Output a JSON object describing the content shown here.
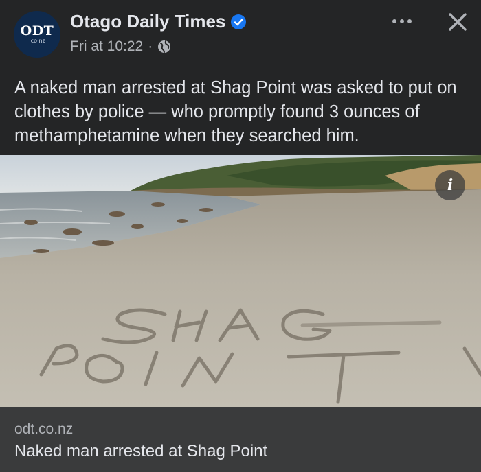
{
  "post": {
    "avatar": {
      "logo_main": "ODT",
      "logo_sub": "·co·nz"
    },
    "page_name": "Otago Daily Times",
    "timestamp": "Fri at 10:22",
    "separator": "·",
    "text": "A naked man arrested at Shag Point was asked to put on clothes by police — who promptly found 3 ounces of methamphetamine when they searched him.",
    "icons": {
      "verified": "verified-badge-icon",
      "audience": "globe-icon",
      "more": "more-options-icon",
      "close": "close-icon",
      "info": "info-icon"
    },
    "image": {
      "sand_writing": [
        "SHAG",
        "POINT"
      ]
    },
    "info_glyph": "i"
  },
  "link": {
    "domain": "odt.co.nz",
    "title": "Naked man arrested at Shag Point"
  },
  "colors": {
    "background": "#242526",
    "card": "#3a3b3c",
    "text_primary": "#e4e6eb",
    "text_secondary": "#b0b3b8",
    "verified": "#1877f2"
  }
}
